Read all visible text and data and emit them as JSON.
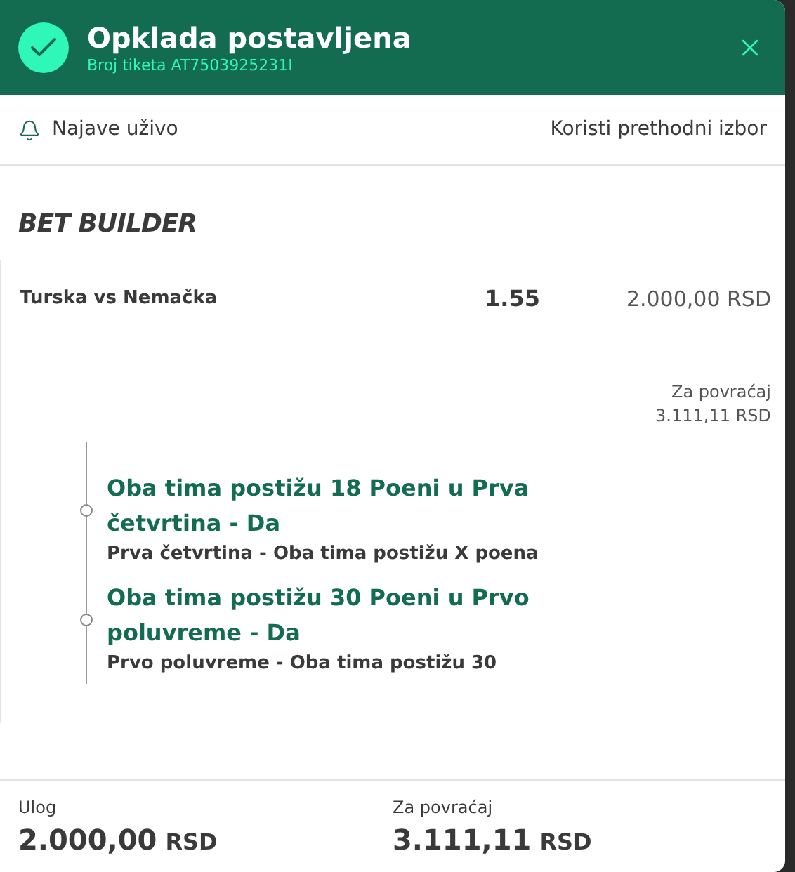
{
  "header": {
    "title": "Opklada postavljena",
    "ticket": "Broj tiketa AT7503925231I"
  },
  "toolbar": {
    "alerts": "Najave uživo",
    "reuse": "Koristi prethodni izbor"
  },
  "bet_type": "BET BUILDER",
  "event": {
    "name": "Turska vs Nemačka",
    "odds": "1.55",
    "stake": "2.000,00 RSD",
    "return_label": "Za povraćaj",
    "return_value": "3.111,11 RSD"
  },
  "selections": [
    {
      "title": "Oba tima postižu 18 Poeni u Prva četvrtina - Da",
      "market": "Prva četvrtina - Oba tima postižu X poena"
    },
    {
      "title": "Oba tima postižu 30 Poeni u Prvo poluvreme - Da",
      "market": "Prvo poluvreme - Oba tima postižu 30"
    }
  ],
  "summary": [
    {
      "label": "Ulog",
      "amount": "2.000,00",
      "currency": "RSD"
    },
    {
      "label": "Za povraćaj",
      "amount": "3.111,11",
      "currency": "RSD"
    }
  ]
}
